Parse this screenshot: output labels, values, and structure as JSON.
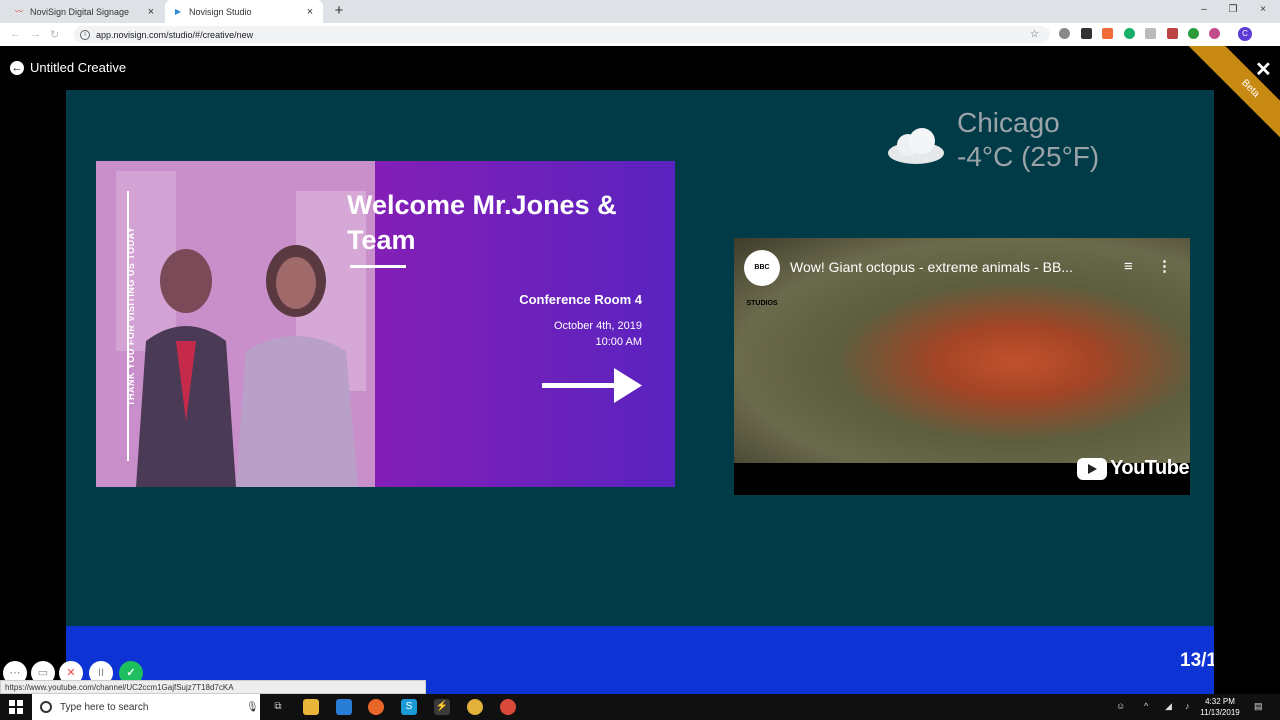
{
  "browser": {
    "tabs": [
      {
        "label": "NoviSign Digital Signage",
        "icon": "novisign-favicon",
        "active": false
      },
      {
        "label": "Novisign Studio",
        "icon": "play-favicon",
        "active": true
      }
    ],
    "new_tab": "+",
    "url": "app.novisign.com/studio/#/creative/new",
    "profile_initial": "C"
  },
  "app": {
    "title": "Untitled Creative",
    "beta": "Beta"
  },
  "banner": {
    "vertical_text": "THANK YOU FOR VISITING US TODAY",
    "welcome": "Welcome Mr.Jones & Team",
    "room": "Conference Room 4",
    "date": "October 4th, 2019",
    "time": "10:00 AM"
  },
  "weather": {
    "city": "Chicago",
    "temperature": "-4°C (25°F)",
    "icon": "cloud-icon"
  },
  "video": {
    "channel": "BBC STUDIOS",
    "title": "Wow! Giant octopus - extreme animals - BB...",
    "logo": "YouTube"
  },
  "page_counter": "13/1",
  "status_url": "https://www.youtube.com/channel/UC2ccm1GajfSujz7T18d7cKA",
  "taskbar": {
    "search_placeholder": "Type here to search",
    "time": "4:32 PM",
    "date": "11/13/2019"
  },
  "colors": {
    "canvas": "#023b48",
    "band": "#0d33d4",
    "beta": "#c98a13",
    "confirm": "#1dbf5e"
  }
}
